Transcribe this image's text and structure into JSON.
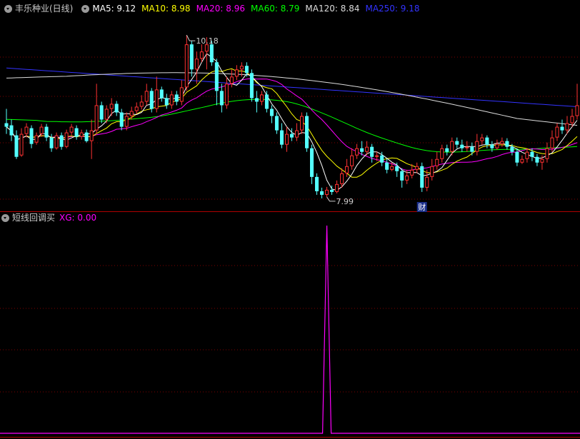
{
  "header": {
    "stock_name": "丰乐种业(日线)",
    "ma": [
      {
        "label": "MA5: 9.12",
        "color": "#ffffff"
      },
      {
        "label": "MA10: 8.98",
        "color": "#ffff00"
      },
      {
        "label": "MA20: 8.96",
        "color": "#ff00ff"
      },
      {
        "label": "MA60: 8.79",
        "color": "#00ff00"
      },
      {
        "label": "MA120: 8.84",
        "color": "#dcdcdc"
      },
      {
        "label": "MA250: 9.18",
        "color": "#3333ff"
      }
    ]
  },
  "indicator": {
    "name": "短线回调买",
    "value_label": "XG: 0.00",
    "value_color": "#ff00ff"
  },
  "colors": {
    "up": "#ff3232",
    "down": "#54ffff",
    "grid": "#800000",
    "ma5": "#ffffff",
    "ma10": "#ffff00",
    "ma20": "#ff00ff",
    "ma60": "#00ff00",
    "ma120": "#dcdcdc",
    "ma250": "#3333ff",
    "xg": "#ff00ff",
    "annot": "#cccccc",
    "badge_text": "#ffffff",
    "badge_bg": "#1a2f8a"
  },
  "chart_data": [
    {
      "type": "candlestick",
      "title": "丰乐种业(日线)",
      "price_range": [
        7.75,
        10.45
      ],
      "candles": [
        [
          8.95,
          8.9,
          9.15,
          8.8
        ],
        [
          8.92,
          8.78,
          9.0,
          8.7
        ],
        [
          8.78,
          8.48,
          8.85,
          8.45
        ],
        [
          8.5,
          8.8,
          8.88,
          8.48
        ],
        [
          8.8,
          8.9,
          8.95,
          8.75
        ],
        [
          8.88,
          8.66,
          8.92,
          8.6
        ],
        [
          8.68,
          8.78,
          8.82,
          8.65
        ],
        [
          8.8,
          8.9,
          8.94,
          8.76
        ],
        [
          8.9,
          8.75,
          8.94,
          8.7
        ],
        [
          8.75,
          8.6,
          8.8,
          8.55
        ],
        [
          8.6,
          8.78,
          8.82,
          8.58
        ],
        [
          8.78,
          8.62,
          8.82,
          8.58
        ],
        [
          8.62,
          8.82,
          8.86,
          8.6
        ],
        [
          8.82,
          8.9,
          8.94,
          8.78
        ],
        [
          8.88,
          8.76,
          8.92,
          8.72
        ],
        [
          8.76,
          8.82,
          8.86,
          8.72
        ],
        [
          8.82,
          8.7,
          8.86,
          8.68
        ],
        [
          8.7,
          8.85,
          9.0,
          8.45
        ],
        [
          8.85,
          9.2,
          9.5,
          8.8
        ],
        [
          9.2,
          9.0,
          9.25,
          8.95
        ],
        [
          9.0,
          9.15,
          9.2,
          8.95
        ],
        [
          9.15,
          9.22,
          9.3,
          9.05
        ],
        [
          9.22,
          9.1,
          9.26,
          9.05
        ],
        [
          9.1,
          8.9,
          9.15,
          8.85
        ],
        [
          8.9,
          9.05,
          9.1,
          8.85
        ],
        [
          9.05,
          9.12,
          9.18,
          9.0
        ],
        [
          9.12,
          9.18,
          9.24,
          9.08
        ],
        [
          9.18,
          9.25,
          9.34,
          9.14
        ],
        [
          9.25,
          9.4,
          9.5,
          9.2
        ],
        [
          9.4,
          9.15,
          9.44,
          9.1
        ],
        [
          9.15,
          9.42,
          9.6,
          9.1
        ],
        [
          9.42,
          9.3,
          9.46,
          9.25
        ],
        [
          9.3,
          9.2,
          9.36,
          9.15
        ],
        [
          9.2,
          9.35,
          9.4,
          9.15
        ],
        [
          9.35,
          9.25,
          9.4,
          9.2
        ],
        [
          9.25,
          9.45,
          9.55,
          9.2
        ],
        [
          9.45,
          10.05,
          10.18,
          9.4
        ],
        [
          10.05,
          9.7,
          10.1,
          9.6
        ],
        [
          9.7,
          9.85,
          9.95,
          9.5
        ],
        [
          9.85,
          9.95,
          10.05,
          9.8
        ],
        [
          9.95,
          10.05,
          10.15,
          9.7
        ],
        [
          10.05,
          9.8,
          10.1,
          9.75
        ],
        [
          9.8,
          9.4,
          9.85,
          9.2
        ],
        [
          9.4,
          9.2,
          9.5,
          9.1
        ],
        [
          9.2,
          9.5,
          9.6,
          9.15
        ],
        [
          9.5,
          9.6,
          9.7,
          9.45
        ],
        [
          9.6,
          9.7,
          9.76,
          9.55
        ],
        [
          9.7,
          9.75,
          9.8,
          9.6
        ],
        [
          9.75,
          9.65,
          9.8,
          9.6
        ],
        [
          9.65,
          9.3,
          9.7,
          9.25
        ],
        [
          9.3,
          9.25,
          9.4,
          9.1
        ],
        [
          9.25,
          9.35,
          9.4,
          9.2
        ],
        [
          9.35,
          9.15,
          9.4,
          9.1
        ],
        [
          9.15,
          9.05,
          9.2,
          8.95
        ],
        [
          9.05,
          8.85,
          9.1,
          8.8
        ],
        [
          8.85,
          8.65,
          8.95,
          8.6
        ],
        [
          8.65,
          8.8,
          8.9,
          8.55
        ],
        [
          8.8,
          8.75,
          8.88,
          8.7
        ],
        [
          8.75,
          8.85,
          8.95,
          8.7
        ],
        [
          8.85,
          9.05,
          9.1,
          8.8
        ],
        [
          9.05,
          8.6,
          9.1,
          8.55
        ],
        [
          8.6,
          8.2,
          8.65,
          8.1
        ],
        [
          8.2,
          8.0,
          8.25,
          7.95
        ],
        [
          8.0,
          7.95,
          8.05,
          7.9
        ],
        [
          7.95,
          8.02,
          8.06,
          7.92
        ],
        [
          8.02,
          7.99,
          8.08,
          7.95
        ],
        [
          7.99,
          8.1,
          8.15,
          7.97
        ],
        [
          8.1,
          8.25,
          8.32,
          8.05
        ],
        [
          8.25,
          8.35,
          8.45,
          8.2
        ],
        [
          8.35,
          8.5,
          8.6,
          8.3
        ],
        [
          8.5,
          8.6,
          8.66,
          8.45
        ],
        [
          8.6,
          8.55,
          8.7,
          8.5
        ],
        [
          8.55,
          8.62,
          8.7,
          8.5
        ],
        [
          8.62,
          8.48,
          8.66,
          8.4
        ],
        [
          8.48,
          8.5,
          8.55,
          8.42
        ],
        [
          8.5,
          8.4,
          8.55,
          8.35
        ],
        [
          8.4,
          8.3,
          8.45,
          8.25
        ],
        [
          8.3,
          8.35,
          8.4,
          8.28
        ],
        [
          8.35,
          8.28,
          8.4,
          8.2
        ],
        [
          8.28,
          8.15,
          8.32,
          8.05
        ],
        [
          8.15,
          8.22,
          8.3,
          8.1
        ],
        [
          8.22,
          8.3,
          8.38,
          8.18
        ],
        [
          8.3,
          8.35,
          8.4,
          8.25
        ],
        [
          8.35,
          8.05,
          8.4,
          7.99
        ],
        [
          8.05,
          8.2,
          8.3,
          8.0
        ],
        [
          8.2,
          8.35,
          8.45,
          8.15
        ],
        [
          8.35,
          8.45,
          8.55,
          8.3
        ],
        [
          8.45,
          8.6,
          8.65,
          8.4
        ],
        [
          8.6,
          8.55,
          8.65,
          8.5
        ],
        [
          8.55,
          8.7,
          8.75,
          8.5
        ],
        [
          8.7,
          8.65,
          8.75,
          8.6
        ],
        [
          8.65,
          8.6,
          8.72,
          8.55
        ],
        [
          8.6,
          8.62,
          8.7,
          8.55
        ],
        [
          8.62,
          8.55,
          8.68,
          8.5
        ],
        [
          8.55,
          8.7,
          8.8,
          8.5
        ],
        [
          8.7,
          8.75,
          8.8,
          8.65
        ],
        [
          8.75,
          8.65,
          8.78,
          8.6
        ],
        [
          8.65,
          8.6,
          8.7,
          8.55
        ],
        [
          8.6,
          8.66,
          8.72,
          8.58
        ],
        [
          8.66,
          8.7,
          8.75,
          8.62
        ],
        [
          8.7,
          8.62,
          8.74,
          8.58
        ],
        [
          8.62,
          8.55,
          8.66,
          8.5
        ],
        [
          8.55,
          8.4,
          8.6,
          8.35
        ],
        [
          8.4,
          8.45,
          8.5,
          8.38
        ],
        [
          8.45,
          8.55,
          8.6,
          8.4
        ],
        [
          8.55,
          8.48,
          8.6,
          8.42
        ],
        [
          8.48,
          8.4,
          8.52,
          8.35
        ],
        [
          8.4,
          8.45,
          8.5,
          8.3
        ],
        [
          8.45,
          8.6,
          8.68,
          8.4
        ],
        [
          8.6,
          8.75,
          8.85,
          8.55
        ],
        [
          8.75,
          8.9,
          8.95,
          8.7
        ],
        [
          8.9,
          8.85,
          9.0,
          8.8
        ],
        [
          8.85,
          8.95,
          9.05,
          8.8
        ],
        [
          8.95,
          9.05,
          9.15,
          8.9
        ],
        [
          9.05,
          9.2,
          9.5,
          9.0
        ]
      ],
      "annotations": [
        {
          "label": "10.18",
          "candle": 36,
          "price": 10.18
        },
        {
          "label": "7.99",
          "candle": 64,
          "price": 7.92
        }
      ],
      "badge": {
        "label": "财",
        "candle": 83
      }
    },
    {
      "type": "line",
      "title": "短线回调买",
      "series": [
        {
          "name": "XG",
          "signal_index": 64,
          "values_note_x": [],
          "ylim": [
            0,
            1
          ]
        }
      ]
    }
  ]
}
